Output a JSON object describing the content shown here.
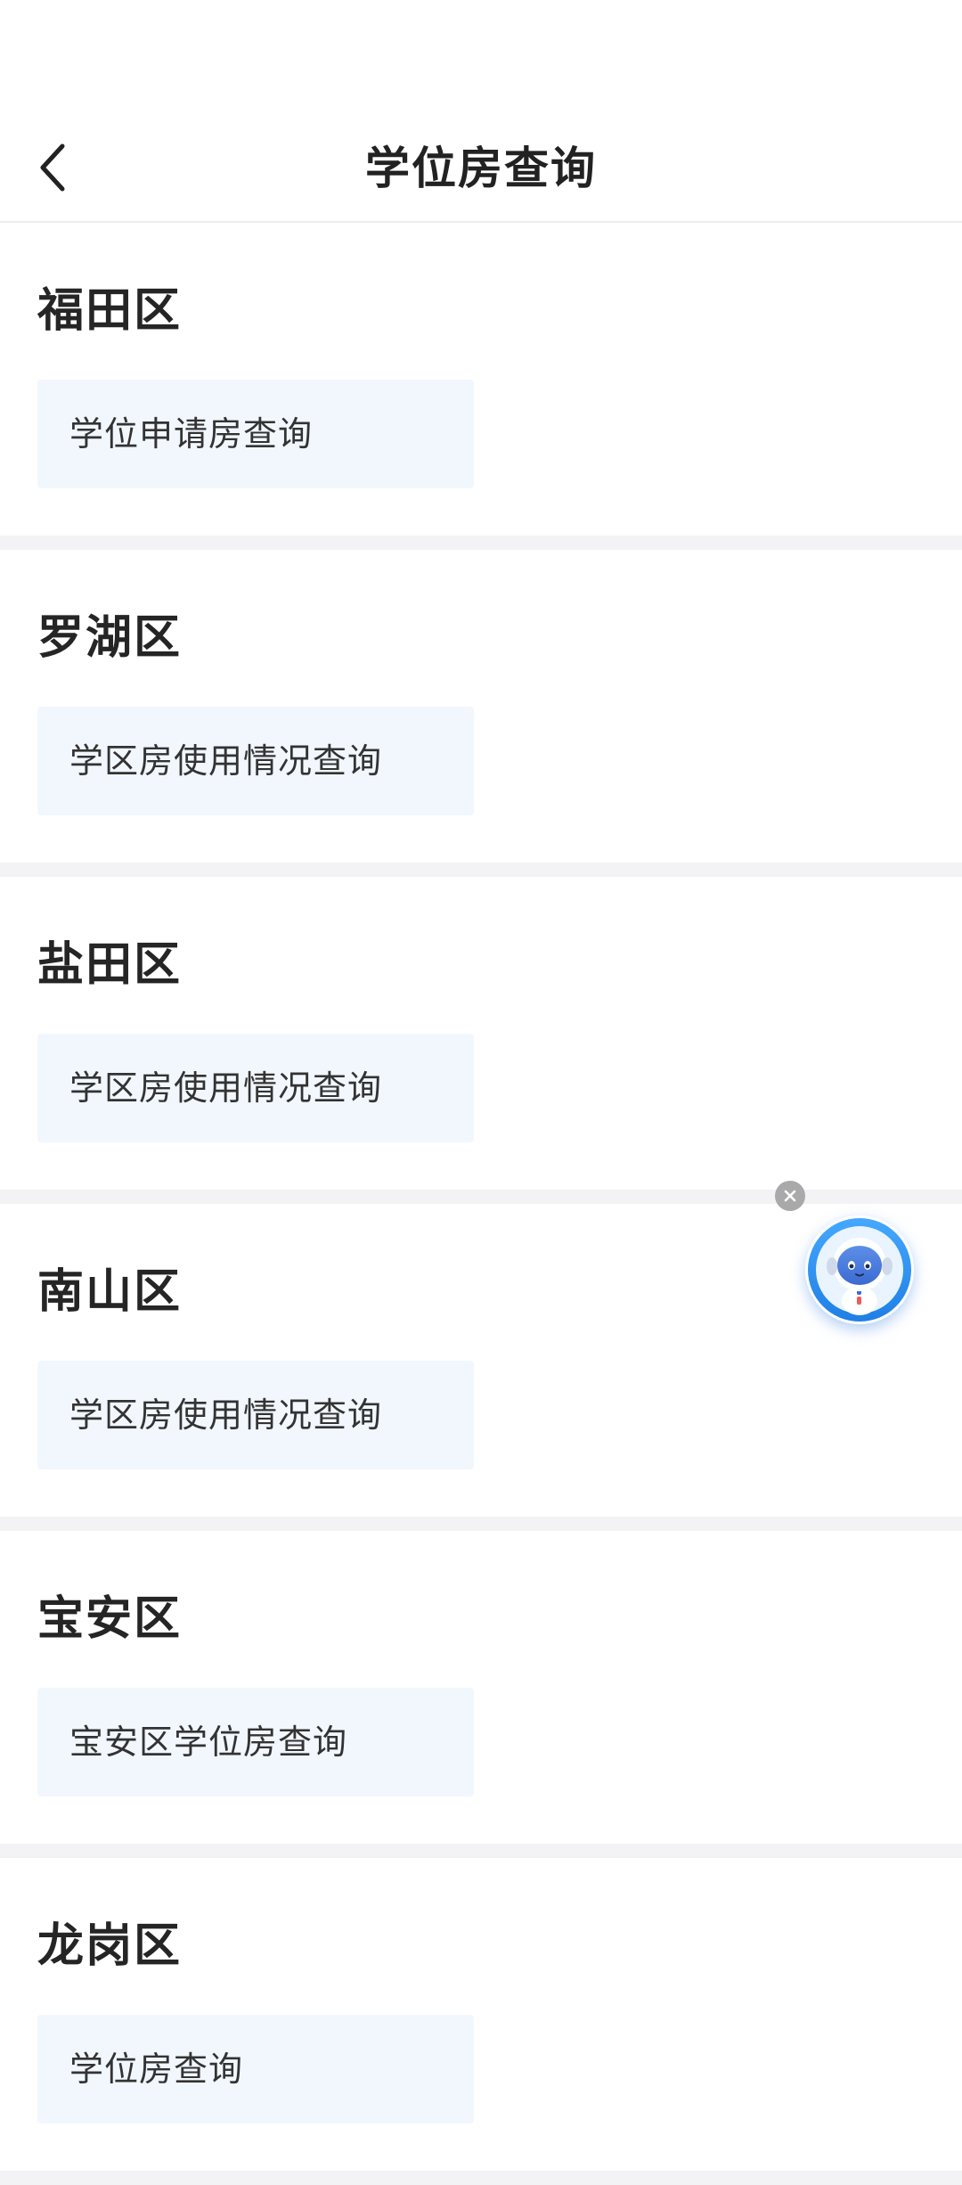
{
  "header": {
    "title": "学位房查询",
    "back_icon": "chevron-left-icon"
  },
  "districts": [
    {
      "name": "福田区",
      "link": "学位申请房查询"
    },
    {
      "name": "罗湖区",
      "link": "学区房使用情况查询"
    },
    {
      "name": "盐田区",
      "link": "学区房使用情况查询"
    },
    {
      "name": "南山区",
      "link": "学区房使用情况查询"
    },
    {
      "name": "宝安区",
      "link": "宝安区学位房查询"
    },
    {
      "name": "龙岗区",
      "link": "学位房查询"
    }
  ],
  "assistant": {
    "icon": "robot-assistant-icon",
    "close_icon": "close-icon"
  },
  "colors": {
    "page_background": "#ffffff",
    "separator": "#f3f3f5",
    "button_background": "#f2f7fe",
    "assistant_blue": "#2f8ff0"
  }
}
